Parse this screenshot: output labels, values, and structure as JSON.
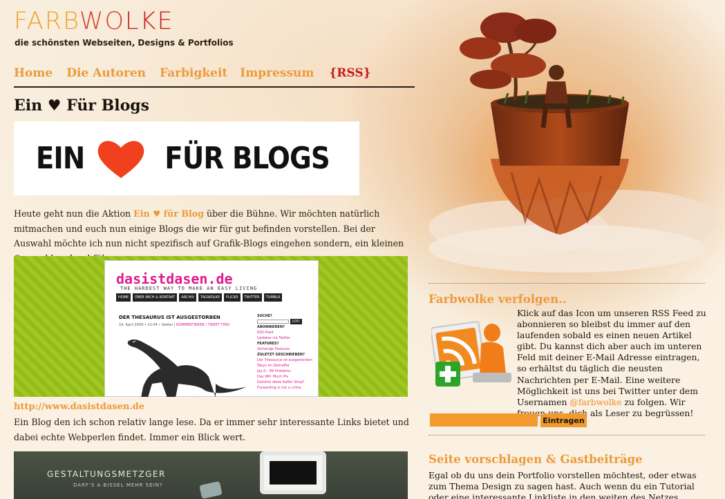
{
  "header": {
    "logo_part1": "FARB",
    "logo_part2": "WO",
    "logo_part3": "LKE",
    "tagline": "die schönsten Webseiten, Designs & Portfolios"
  },
  "nav": {
    "items": [
      "Home",
      "Die Autoren",
      "Farbigkeit",
      "Impressum",
      "{RSS}"
    ]
  },
  "article": {
    "title": "Ein ♥ Für Blogs",
    "banner_left": "EIN",
    "banner_right": "FÜR BLOGS",
    "intro_before": "Heute geht nun die Aktion ",
    "intro_link": "Ein ♥ für Blog",
    "intro_after": " über die Bühne. Wir möchten natürlich mitmachen und euch nun einige Blogs die wir für gut befinden vorstellen. Bei der Auswahl möchte ich nun nicht spezifisch auf Grafik-Blogs eingehen sondern, ein kleinen Querschlag durchführen.",
    "entries": [
      {
        "url": "http://www.dasistdasen.de",
        "description": "Ein Blog den ich schon relativ lange lese. Da er immer sehr interessante Links bietet und dabei echte Webperlen findet. Immer ein Blick wert.",
        "shot": {
          "site_title": "dasistdasen.de",
          "site_sub": "THE HARDEST WAY TO MAKE AN EASY LIVING",
          "menu": [
            "HOME",
            "ÜBER MICH & KONTAKT",
            "ARCHIV",
            "TAGWOLKE",
            "FLICKR",
            "TWITTER",
            "TUMBLR"
          ],
          "post_title": "DER THESAURUS IST AUSGESTORBEN",
          "post_date": "19. April 2009 • 12:04 • Stefan | ",
          "post_meta": "KOMMENTIEREN | TWEET THIS!",
          "search_label": "SUCHE?",
          "search_button": "LOS!",
          "subscribe_label": "ABONNIEREN?",
          "subscribe_links": [
            "RSS-Feed",
            "Updates via Twitter"
          ],
          "features_label": "FEATURES?",
          "features_link": "Vorherige Features",
          "recent_label": "ZULETZT GESCHRIEBEN?",
          "recent_links": [
            "Der Thesaurus ist ausgestorben",
            "Tokyo im Zeitraffer",
            "Jay-Z - 99 Problems",
            "Das Wtf- Much Pix",
            "Gehörte diese Kaffer Shop?",
            "Forwarding is not a crime"
          ]
        }
      },
      {
        "shot": {
          "title": "GESTALTUNGSMETZGER",
          "subtitle": "DARF'S A BISSEL MEHR SEIN?"
        }
      }
    ]
  },
  "sidebar": {
    "follow": {
      "title": "Farbwolke verfolgen..",
      "text_before": "Klick auf das Icon um unseren RSS Feed zu abonnieren so bleibst du immer auf den laufenden sobald es einen neuen Artikel gibt. Du kannst dich aber auch im unteren Feld mit deiner E-Mail Adresse eintragen, so erhältst du täglich die neusten Nachrichten per E-Mail. Eine weitere Möglichkeit ist uns bei Twitter unter dem Usernamen ",
      "twitter_handle": "@farbwolke",
      "text_after": " zu folgen. Wir freuen uns, dich als Leser zu begrüssen!",
      "email_value": "",
      "button": "Eintragen"
    },
    "suggest": {
      "title": "Seite vorschlagen & Gastbeiträge",
      "text": "Egal ob du uns dein Portfolio vorstellen möchtest, oder etwas zum Thema Design zu sagen hast. Auch wenn du ein Tutorial oder eine interessante Linkliste in den weiten des Netzes gefunden hast."
    }
  },
  "colors": {
    "accent_orange": "#ec9a3b",
    "rss_red": "#c21d1d",
    "heart_red": "#f0401e",
    "button_orange": "#f29a2e",
    "dasistdasen_green": "#9ac417",
    "dasistdasen_pink": "#e01a8c"
  },
  "icons": [
    "heart-icon",
    "rss-reader-icon",
    "plus-icon",
    "dinosaur-illustration",
    "tree-pot-illustration"
  ]
}
